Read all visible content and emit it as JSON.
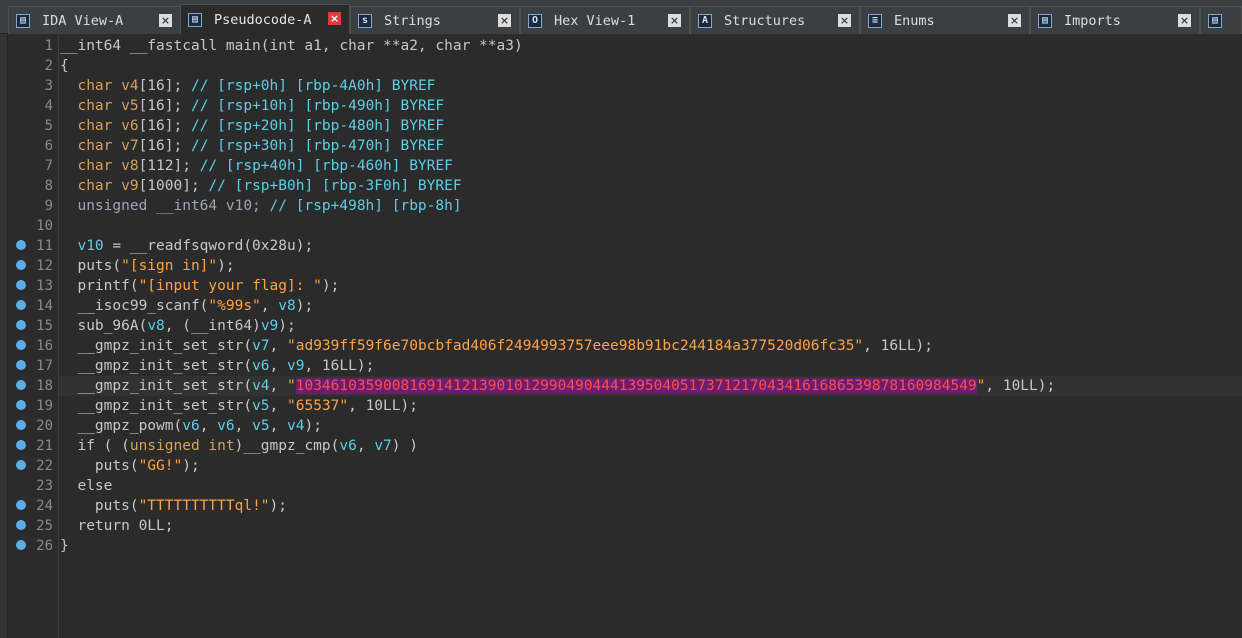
{
  "tabs": [
    {
      "label": "IDA View-A",
      "icon": "ida-view-icon",
      "glyph": "▤",
      "active": false
    },
    {
      "label": "Pseudocode-A",
      "icon": "pseudocode-icon",
      "glyph": "▤",
      "active": true
    },
    {
      "label": "Strings",
      "icon": "strings-icon",
      "glyph": "s",
      "active": false
    },
    {
      "label": "Hex View-1",
      "icon": "hex-view-icon",
      "glyph": "O",
      "active": false
    },
    {
      "label": "Structures",
      "icon": "structures-icon",
      "glyph": "A",
      "active": false
    },
    {
      "label": "Enums",
      "icon": "enums-icon",
      "glyph": "≡",
      "active": false
    },
    {
      "label": "Imports",
      "icon": "imports-icon",
      "glyph": "▤",
      "active": false
    },
    {
      "label": "",
      "icon": "exports-icon",
      "glyph": "▤",
      "active": false
    }
  ],
  "code": [
    {
      "n": "1",
      "dot": false,
      "segs": [
        [
          "plain",
          "__int64 __fastcall main(int a1, char **a2, char **a3)"
        ]
      ]
    },
    {
      "n": "2",
      "dot": false,
      "segs": [
        [
          "plain",
          "{"
        ]
      ]
    },
    {
      "n": "3",
      "dot": false,
      "segs": [
        [
          "kw",
          "  char v4"
        ],
        [
          "plain",
          "[16]; "
        ],
        [
          "cm",
          "// [rsp+0h] [rbp-4A0h] BYREF"
        ]
      ]
    },
    {
      "n": "4",
      "dot": false,
      "segs": [
        [
          "kw",
          "  char v5"
        ],
        [
          "plain",
          "[16]; "
        ],
        [
          "cm",
          "// [rsp+10h] [rbp-490h] BYREF"
        ]
      ]
    },
    {
      "n": "5",
      "dot": false,
      "segs": [
        [
          "kw",
          "  char v6"
        ],
        [
          "plain",
          "[16]; "
        ],
        [
          "cm",
          "// [rsp+20h] [rbp-480h] BYREF"
        ]
      ]
    },
    {
      "n": "6",
      "dot": false,
      "segs": [
        [
          "kw",
          "  char v7"
        ],
        [
          "plain",
          "[16]; "
        ],
        [
          "cm",
          "// [rsp+30h] [rbp-470h] BYREF"
        ]
      ]
    },
    {
      "n": "7",
      "dot": false,
      "segs": [
        [
          "kw",
          "  char v8"
        ],
        [
          "plain",
          "[112]; "
        ],
        [
          "cm",
          "// [rsp+40h] [rbp-460h] BYREF"
        ]
      ]
    },
    {
      "n": "8",
      "dot": false,
      "segs": [
        [
          "kw",
          "  char v9"
        ],
        [
          "plain",
          "[1000]; "
        ],
        [
          "cm",
          "// [rsp+B0h] [rbp-3F0h] BYREF"
        ]
      ]
    },
    {
      "n": "9",
      "dot": false,
      "segs": [
        [
          "dim",
          "  unsigned __int64 v10; "
        ],
        [
          "cm",
          "// [rsp+498h] [rbp-8h]"
        ]
      ]
    },
    {
      "n": "10",
      "dot": false,
      "segs": [
        [
          "plain",
          ""
        ]
      ]
    },
    {
      "n": "11",
      "dot": true,
      "segs": [
        [
          "var",
          "  v10"
        ],
        [
          "plain",
          " = __readfsqword(0x28u);"
        ]
      ]
    },
    {
      "n": "12",
      "dot": true,
      "segs": [
        [
          "plain",
          "  puts("
        ],
        [
          "str",
          "\"[sign in]\""
        ],
        [
          "plain",
          ");"
        ]
      ]
    },
    {
      "n": "13",
      "dot": true,
      "segs": [
        [
          "plain",
          "  printf("
        ],
        [
          "str",
          "\"[input your flag]: \""
        ],
        [
          "plain",
          ");"
        ]
      ]
    },
    {
      "n": "14",
      "dot": true,
      "segs": [
        [
          "plain",
          "  __isoc99_scanf("
        ],
        [
          "str",
          "\"%99s\""
        ],
        [
          "plain",
          ", "
        ],
        [
          "var",
          "v8"
        ],
        [
          "plain",
          ");"
        ]
      ]
    },
    {
      "n": "15",
      "dot": true,
      "segs": [
        [
          "plain",
          "  sub_96A("
        ],
        [
          "var",
          "v8"
        ],
        [
          "plain",
          ", (__int64)"
        ],
        [
          "var",
          "v9"
        ],
        [
          "plain",
          ");"
        ]
      ]
    },
    {
      "n": "16",
      "dot": true,
      "segs": [
        [
          "plain",
          "  __gmpz_init_set_str("
        ],
        [
          "var",
          "v7"
        ],
        [
          "plain",
          ", "
        ],
        [
          "str",
          "\"ad939ff59f6e70bcbfad406f2494993757eee98b91bc244184a377520d06fc35\""
        ],
        [
          "plain",
          ", 16LL);"
        ]
      ]
    },
    {
      "n": "17",
      "dot": true,
      "segs": [
        [
          "plain",
          "  __gmpz_init_set_str("
        ],
        [
          "var",
          "v6"
        ],
        [
          "plain",
          ", "
        ],
        [
          "var",
          "v9"
        ],
        [
          "plain",
          ", 16LL);"
        ]
      ]
    },
    {
      "n": "18",
      "dot": true,
      "hl": true,
      "segs": [
        [
          "plain",
          "  __gmpz_init_set_str("
        ],
        [
          "var",
          "v4"
        ],
        [
          "plain",
          ", "
        ],
        [
          "str",
          "\""
        ],
        [
          "sel",
          "103461035900816914121390101299049044413950405173712170434161686539878160984549"
        ],
        [
          "str",
          "\""
        ],
        [
          "plain",
          ", 10LL);"
        ]
      ]
    },
    {
      "n": "19",
      "dot": true,
      "segs": [
        [
          "plain",
          "  __gmpz_init_set_str("
        ],
        [
          "var",
          "v5"
        ],
        [
          "plain",
          ", "
        ],
        [
          "str",
          "\"65537\""
        ],
        [
          "plain",
          ", 10LL);"
        ]
      ]
    },
    {
      "n": "20",
      "dot": true,
      "segs": [
        [
          "plain",
          "  __gmpz_powm("
        ],
        [
          "var",
          "v6"
        ],
        [
          "plain",
          ", "
        ],
        [
          "var",
          "v6"
        ],
        [
          "plain",
          ", "
        ],
        [
          "var",
          "v5"
        ],
        [
          "plain",
          ", "
        ],
        [
          "var",
          "v4"
        ],
        [
          "plain",
          ");"
        ]
      ]
    },
    {
      "n": "21",
      "dot": true,
      "segs": [
        [
          "plain",
          "  if ( ("
        ],
        [
          "kw",
          "unsigned int"
        ],
        [
          "plain",
          ")__gmpz_cmp("
        ],
        [
          "var",
          "v6"
        ],
        [
          "plain",
          ", "
        ],
        [
          "var",
          "v7"
        ],
        [
          "plain",
          ") )"
        ]
      ]
    },
    {
      "n": "22",
      "dot": true,
      "segs": [
        [
          "plain",
          "    puts("
        ],
        [
          "str",
          "\"GG!\""
        ],
        [
          "plain",
          ");"
        ]
      ]
    },
    {
      "n": "23",
      "dot": false,
      "segs": [
        [
          "plain",
          "  else"
        ]
      ]
    },
    {
      "n": "24",
      "dot": true,
      "segs": [
        [
          "plain",
          "    puts("
        ],
        [
          "str",
          "\"TTTTTTTTTTql!\""
        ],
        [
          "plain",
          ");"
        ]
      ]
    },
    {
      "n": "25",
      "dot": true,
      "segs": [
        [
          "plain",
          "  return 0LL;"
        ]
      ]
    },
    {
      "n": "26",
      "dot": true,
      "segs": [
        [
          "plain",
          "}"
        ]
      ]
    }
  ]
}
